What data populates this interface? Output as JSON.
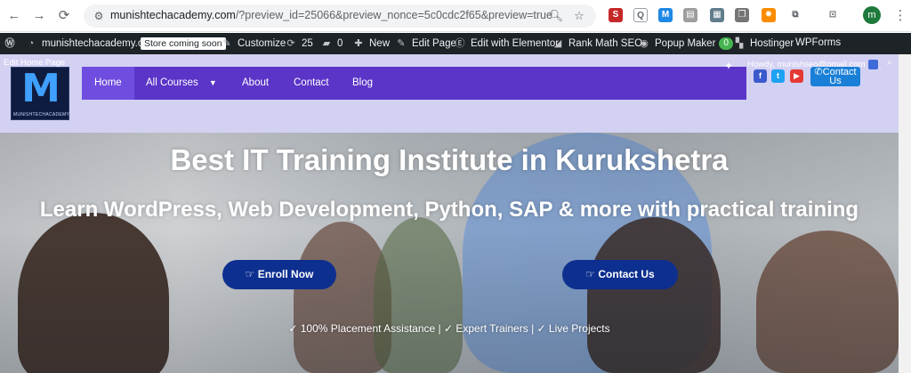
{
  "browser": {
    "url_host": "munishtechacademy.com",
    "url_rest": "/?preview_id=25066&preview_nonce=5c0cdc2f65&preview=true",
    "profile_initial": "m"
  },
  "wpbar": {
    "site_name": "munishtechacademy.com",
    "store_badge": "Store coming soon",
    "customize": "Customize",
    "updates_count": "25",
    "comments_count": "0",
    "new": "New",
    "edit_page": "Edit Page",
    "elementor": "Edit with Elementor",
    "rankmath": "Rank Math SEO",
    "popup": "Popup Maker",
    "popup_count": "0",
    "hostinger": "Hostinger",
    "wpforms": "WPForms"
  },
  "site": {
    "edit_link": "Edit Home Page",
    "logo_brand": "MUNISHTECHACADEMY",
    "howdy": "Howdy, munishseo@gmail.com",
    "menu": [
      {
        "label": "Home"
      },
      {
        "label": "All Courses"
      },
      {
        "label": "About"
      },
      {
        "label": "Contact"
      },
      {
        "label": "Blog"
      }
    ],
    "contact_top": "Contact Us"
  },
  "hero": {
    "title": "Best IT Training Institute in Kurukshetra",
    "subtitle": "Learn WordPress, Web Development, Python, SAP & more with practical training",
    "enroll": "Enroll Now",
    "contact": "Contact Us",
    "features": [
      "100% Placement Assistance",
      "Expert Trainers",
      "Live Projects"
    ]
  },
  "colors": {
    "menu_bg": "#5a35c8",
    "header_bg": "#d3d1f2",
    "cta_bg": "#0d2f8f",
    "wpbar_bg": "#1d2327"
  }
}
